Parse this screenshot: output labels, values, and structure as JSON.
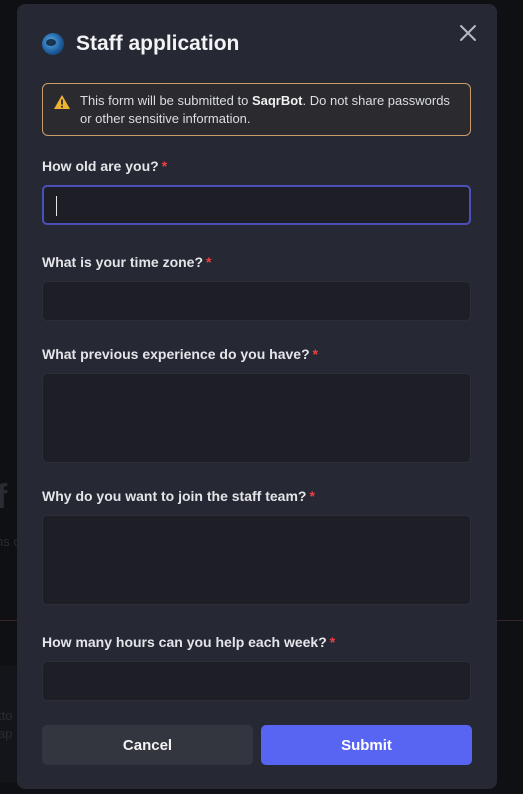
{
  "background": {
    "big_text": "f",
    "small_text": "ns c",
    "panel_line_1": "tto",
    "panel_line_2": "ap"
  },
  "modal": {
    "title": "Staff application",
    "app_icon": "globe-avatar-icon",
    "close_icon": "close-icon"
  },
  "notice": {
    "icon": "warning-icon",
    "text_before": "This form will be submitted to ",
    "bot_name": "SaqrBot",
    "text_after": ". Do not share passwords or other sensitive information.",
    "border_color": "#c79e6b"
  },
  "questions": [
    {
      "label": "How old are you?",
      "required": "*",
      "value": ""
    },
    {
      "label": "What is your time zone?",
      "required": "*",
      "value": ""
    },
    {
      "label": "What previous experience do you have?",
      "required": "*",
      "value": ""
    },
    {
      "label": "Why do you want to join the staff team?",
      "required": "*",
      "value": ""
    },
    {
      "label": "How many hours can you help each week?",
      "required": "*",
      "value": ""
    }
  ],
  "buttons": {
    "cancel_label": "Cancel",
    "submit_label": "Submit",
    "submit_color": "#5865f2"
  }
}
